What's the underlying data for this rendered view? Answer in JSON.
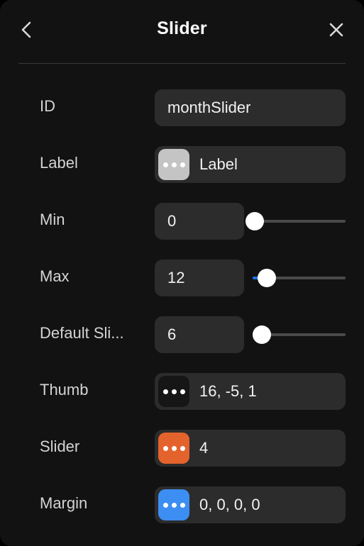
{
  "header": {
    "title": "Slider",
    "back_icon": "chevron-left-icon",
    "close_icon": "close-icon"
  },
  "rows": [
    {
      "label": "ID",
      "field_kind": "wide",
      "value": "monthSlider",
      "badge": null,
      "slider": null
    },
    {
      "label": "Label",
      "field_kind": "wide",
      "value": "Label",
      "badge": {
        "color": "#c4c4c4",
        "icon": "ellipsis-icon"
      },
      "slider": null
    },
    {
      "label": "Min",
      "field_kind": "narrow",
      "value": "0",
      "badge": null,
      "slider": {
        "fill_percent": 0,
        "thumb_percent": 2
      }
    },
    {
      "label": "Max",
      "field_kind": "narrow",
      "value": "12",
      "badge": null,
      "slider": {
        "fill_percent": 12,
        "thumb_percent": 15
      }
    },
    {
      "label": "Default Sli...",
      "field_kind": "narrow",
      "value": "6",
      "badge": null,
      "slider": {
        "fill_percent": 4,
        "thumb_percent": 10
      }
    },
    {
      "label": "Thumb",
      "field_kind": "wide",
      "value": "16, -5, 1",
      "badge": {
        "color": "#161616",
        "icon": "ellipsis-icon"
      },
      "slider": null
    },
    {
      "label": "Slider",
      "field_kind": "wide",
      "value": "4",
      "badge": {
        "color": "#e4632c",
        "icon": "ellipsis-icon"
      },
      "slider": null
    },
    {
      "label": "Margin",
      "field_kind": "wide",
      "value": "0, 0, 0, 0",
      "badge": {
        "color": "#3c8ef2",
        "icon": "ellipsis-icon"
      },
      "slider": null
    }
  ],
  "colors": {
    "panel_background": "#121212",
    "field_background": "#2c2c2c",
    "slider_accent": "#1a73e8",
    "slider_track": "#4a4a4a",
    "label_text": "#d4d4d4",
    "value_text": "#f2f2f2"
  }
}
